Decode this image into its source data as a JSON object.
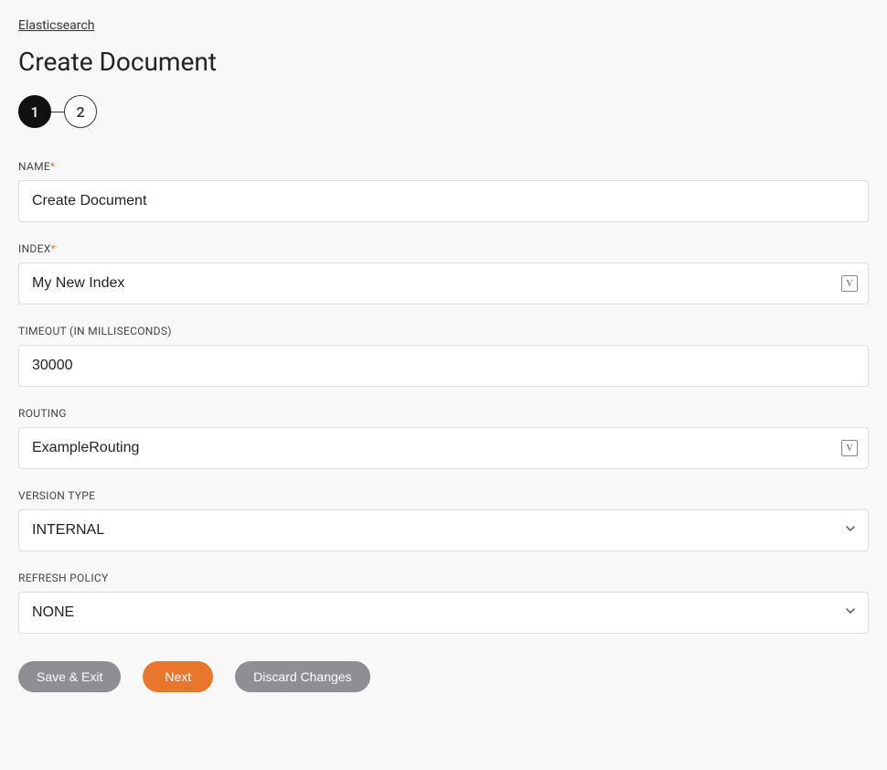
{
  "breadcrumb": "Elasticsearch",
  "pageTitle": "Create Document",
  "stepper": {
    "step1": "1",
    "step2": "2"
  },
  "fields": {
    "name": {
      "label": "NAME",
      "value": "Create Document"
    },
    "index": {
      "label": "INDEX",
      "value": "My New Index"
    },
    "timeout": {
      "label": "TIMEOUT (IN MILLISECONDS)",
      "value": "30000"
    },
    "routing": {
      "label": "ROUTING",
      "value": "ExampleRouting"
    },
    "versionType": {
      "label": "VERSION TYPE",
      "value": "INTERNAL"
    },
    "refreshPolicy": {
      "label": "REFRESH POLICY",
      "value": "NONE"
    }
  },
  "buttons": {
    "saveExit": "Save & Exit",
    "next": "Next",
    "discard": "Discard Changes"
  }
}
